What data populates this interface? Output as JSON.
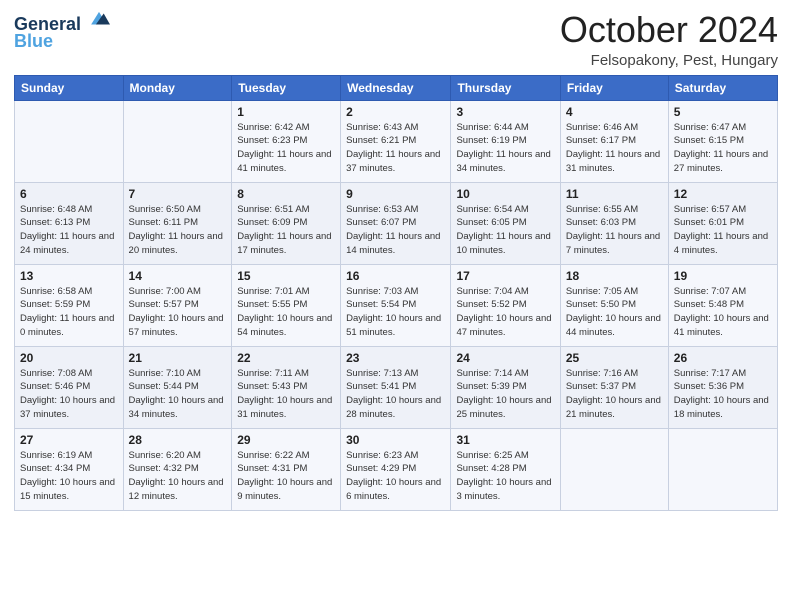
{
  "logo": {
    "line1": "General",
    "line2": "Blue"
  },
  "title": "October 2024",
  "location": "Felsopakony, Pest, Hungary",
  "days_of_week": [
    "Sunday",
    "Monday",
    "Tuesday",
    "Wednesday",
    "Thursday",
    "Friday",
    "Saturday"
  ],
  "weeks": [
    [
      {
        "num": "",
        "sunrise": "",
        "sunset": "",
        "daylight": ""
      },
      {
        "num": "",
        "sunrise": "",
        "sunset": "",
        "daylight": ""
      },
      {
        "num": "1",
        "sunrise": "Sunrise: 6:42 AM",
        "sunset": "Sunset: 6:23 PM",
        "daylight": "Daylight: 11 hours and 41 minutes."
      },
      {
        "num": "2",
        "sunrise": "Sunrise: 6:43 AM",
        "sunset": "Sunset: 6:21 PM",
        "daylight": "Daylight: 11 hours and 37 minutes."
      },
      {
        "num": "3",
        "sunrise": "Sunrise: 6:44 AM",
        "sunset": "Sunset: 6:19 PM",
        "daylight": "Daylight: 11 hours and 34 minutes."
      },
      {
        "num": "4",
        "sunrise": "Sunrise: 6:46 AM",
        "sunset": "Sunset: 6:17 PM",
        "daylight": "Daylight: 11 hours and 31 minutes."
      },
      {
        "num": "5",
        "sunrise": "Sunrise: 6:47 AM",
        "sunset": "Sunset: 6:15 PM",
        "daylight": "Daylight: 11 hours and 27 minutes."
      }
    ],
    [
      {
        "num": "6",
        "sunrise": "Sunrise: 6:48 AM",
        "sunset": "Sunset: 6:13 PM",
        "daylight": "Daylight: 11 hours and 24 minutes."
      },
      {
        "num": "7",
        "sunrise": "Sunrise: 6:50 AM",
        "sunset": "Sunset: 6:11 PM",
        "daylight": "Daylight: 11 hours and 20 minutes."
      },
      {
        "num": "8",
        "sunrise": "Sunrise: 6:51 AM",
        "sunset": "Sunset: 6:09 PM",
        "daylight": "Daylight: 11 hours and 17 minutes."
      },
      {
        "num": "9",
        "sunrise": "Sunrise: 6:53 AM",
        "sunset": "Sunset: 6:07 PM",
        "daylight": "Daylight: 11 hours and 14 minutes."
      },
      {
        "num": "10",
        "sunrise": "Sunrise: 6:54 AM",
        "sunset": "Sunset: 6:05 PM",
        "daylight": "Daylight: 11 hours and 10 minutes."
      },
      {
        "num": "11",
        "sunrise": "Sunrise: 6:55 AM",
        "sunset": "Sunset: 6:03 PM",
        "daylight": "Daylight: 11 hours and 7 minutes."
      },
      {
        "num": "12",
        "sunrise": "Sunrise: 6:57 AM",
        "sunset": "Sunset: 6:01 PM",
        "daylight": "Daylight: 11 hours and 4 minutes."
      }
    ],
    [
      {
        "num": "13",
        "sunrise": "Sunrise: 6:58 AM",
        "sunset": "Sunset: 5:59 PM",
        "daylight": "Daylight: 11 hours and 0 minutes."
      },
      {
        "num": "14",
        "sunrise": "Sunrise: 7:00 AM",
        "sunset": "Sunset: 5:57 PM",
        "daylight": "Daylight: 10 hours and 57 minutes."
      },
      {
        "num": "15",
        "sunrise": "Sunrise: 7:01 AM",
        "sunset": "Sunset: 5:55 PM",
        "daylight": "Daylight: 10 hours and 54 minutes."
      },
      {
        "num": "16",
        "sunrise": "Sunrise: 7:03 AM",
        "sunset": "Sunset: 5:54 PM",
        "daylight": "Daylight: 10 hours and 51 minutes."
      },
      {
        "num": "17",
        "sunrise": "Sunrise: 7:04 AM",
        "sunset": "Sunset: 5:52 PM",
        "daylight": "Daylight: 10 hours and 47 minutes."
      },
      {
        "num": "18",
        "sunrise": "Sunrise: 7:05 AM",
        "sunset": "Sunset: 5:50 PM",
        "daylight": "Daylight: 10 hours and 44 minutes."
      },
      {
        "num": "19",
        "sunrise": "Sunrise: 7:07 AM",
        "sunset": "Sunset: 5:48 PM",
        "daylight": "Daylight: 10 hours and 41 minutes."
      }
    ],
    [
      {
        "num": "20",
        "sunrise": "Sunrise: 7:08 AM",
        "sunset": "Sunset: 5:46 PM",
        "daylight": "Daylight: 10 hours and 37 minutes."
      },
      {
        "num": "21",
        "sunrise": "Sunrise: 7:10 AM",
        "sunset": "Sunset: 5:44 PM",
        "daylight": "Daylight: 10 hours and 34 minutes."
      },
      {
        "num": "22",
        "sunrise": "Sunrise: 7:11 AM",
        "sunset": "Sunset: 5:43 PM",
        "daylight": "Daylight: 10 hours and 31 minutes."
      },
      {
        "num": "23",
        "sunrise": "Sunrise: 7:13 AM",
        "sunset": "Sunset: 5:41 PM",
        "daylight": "Daylight: 10 hours and 28 minutes."
      },
      {
        "num": "24",
        "sunrise": "Sunrise: 7:14 AM",
        "sunset": "Sunset: 5:39 PM",
        "daylight": "Daylight: 10 hours and 25 minutes."
      },
      {
        "num": "25",
        "sunrise": "Sunrise: 7:16 AM",
        "sunset": "Sunset: 5:37 PM",
        "daylight": "Daylight: 10 hours and 21 minutes."
      },
      {
        "num": "26",
        "sunrise": "Sunrise: 7:17 AM",
        "sunset": "Sunset: 5:36 PM",
        "daylight": "Daylight: 10 hours and 18 minutes."
      }
    ],
    [
      {
        "num": "27",
        "sunrise": "Sunrise: 6:19 AM",
        "sunset": "Sunset: 4:34 PM",
        "daylight": "Daylight: 10 hours and 15 minutes."
      },
      {
        "num": "28",
        "sunrise": "Sunrise: 6:20 AM",
        "sunset": "Sunset: 4:32 PM",
        "daylight": "Daylight: 10 hours and 12 minutes."
      },
      {
        "num": "29",
        "sunrise": "Sunrise: 6:22 AM",
        "sunset": "Sunset: 4:31 PM",
        "daylight": "Daylight: 10 hours and 9 minutes."
      },
      {
        "num": "30",
        "sunrise": "Sunrise: 6:23 AM",
        "sunset": "Sunset: 4:29 PM",
        "daylight": "Daylight: 10 hours and 6 minutes."
      },
      {
        "num": "31",
        "sunrise": "Sunrise: 6:25 AM",
        "sunset": "Sunset: 4:28 PM",
        "daylight": "Daylight: 10 hours and 3 minutes."
      },
      {
        "num": "",
        "sunrise": "",
        "sunset": "",
        "daylight": ""
      },
      {
        "num": "",
        "sunrise": "",
        "sunset": "",
        "daylight": ""
      }
    ]
  ]
}
